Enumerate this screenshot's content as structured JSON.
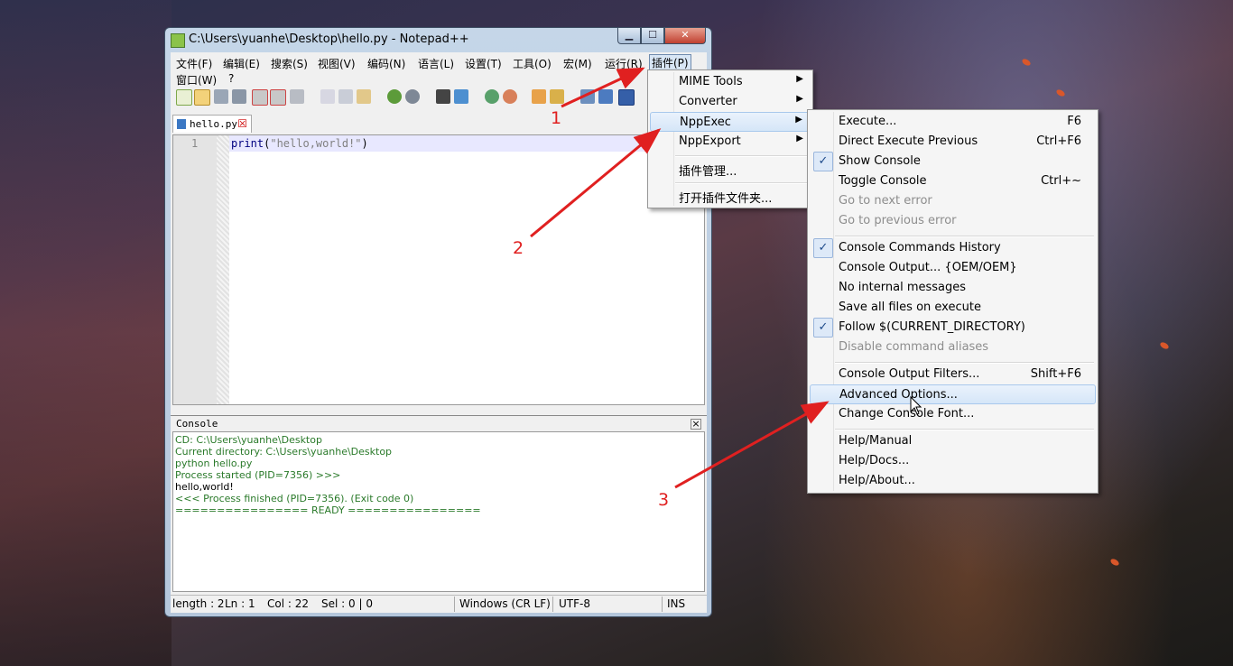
{
  "window": {
    "title": "C:\\Users\\yuanhe\\Desktop\\hello.py - Notepad++",
    "controls": {
      "minimize": "▁",
      "maximize": "☐",
      "close": "✕"
    }
  },
  "menubar": {
    "items": [
      "文件(F)",
      "编辑(E)",
      "搜索(S)",
      "视图(V)",
      "编码(N)",
      "语言(L)",
      "设置(T)",
      "工具(O)",
      "宏(M)",
      "运行(R)",
      "插件(P)"
    ],
    "row2": [
      "窗口(W)",
      "?"
    ]
  },
  "tab": {
    "label": "hello.py",
    "close": "☒"
  },
  "editor": {
    "line_number": "1",
    "code_keyword": "print",
    "code_open": "(",
    "code_string": "\"hello,world!\"",
    "code_close": ")"
  },
  "console": {
    "title": "Console",
    "close": "×",
    "lines": [
      "CD: C:\\Users\\yuanhe\\Desktop",
      "Current directory: C:\\Users\\yuanhe\\Desktop",
      "python hello.py",
      "Process started (PID=7356) >>>",
      "hello,world!",
      "<<< Process finished (PID=7356). (Exit code 0)",
      "================ READY ================"
    ]
  },
  "statusbar": {
    "length": "length : 2",
    "ln": "Ln : 1",
    "col": "Col : 22",
    "sel": "Sel : 0 | 0",
    "eol": "Windows (CR LF)",
    "encoding": "UTF-8",
    "mode": "INS"
  },
  "plugins_menu": {
    "items": [
      "MIME Tools",
      "Converter",
      "NppExec",
      "NppExport",
      "插件管理...",
      "打开插件文件夹..."
    ]
  },
  "nppexec_menu": {
    "items": [
      {
        "label": "Execute...",
        "shortcut": "F6"
      },
      {
        "label": "Direct Execute Previous",
        "shortcut": "Ctrl+F6"
      },
      {
        "label": "Show Console",
        "checked": true
      },
      {
        "label": "Toggle Console",
        "shortcut": "Ctrl+~"
      },
      {
        "label": "Go to next error",
        "disabled": true
      },
      {
        "label": "Go to previous error",
        "disabled": true
      },
      {
        "label": "Console Commands History",
        "checked": true
      },
      {
        "label": "Console Output... {OEM/OEM}"
      },
      {
        "label": "No internal messages"
      },
      {
        "label": "Save all files on execute"
      },
      {
        "label": "Follow $(CURRENT_DIRECTORY)",
        "checked": true
      },
      {
        "label": "Disable command aliases",
        "disabled": true
      },
      {
        "label": "Console Output Filters...",
        "shortcut": "Shift+F6"
      },
      {
        "label": "Advanced Options..."
      },
      {
        "label": "Change Console Font..."
      },
      {
        "label": "Help/Manual"
      },
      {
        "label": "Help/Docs..."
      },
      {
        "label": "Help/About..."
      }
    ],
    "check_glyph": "✓",
    "arrow_glyph": "▶"
  },
  "annotations": [
    "1",
    "2",
    "3"
  ],
  "colors": {
    "annotation": "#e02020",
    "console_text": "#2a7a2a"
  }
}
